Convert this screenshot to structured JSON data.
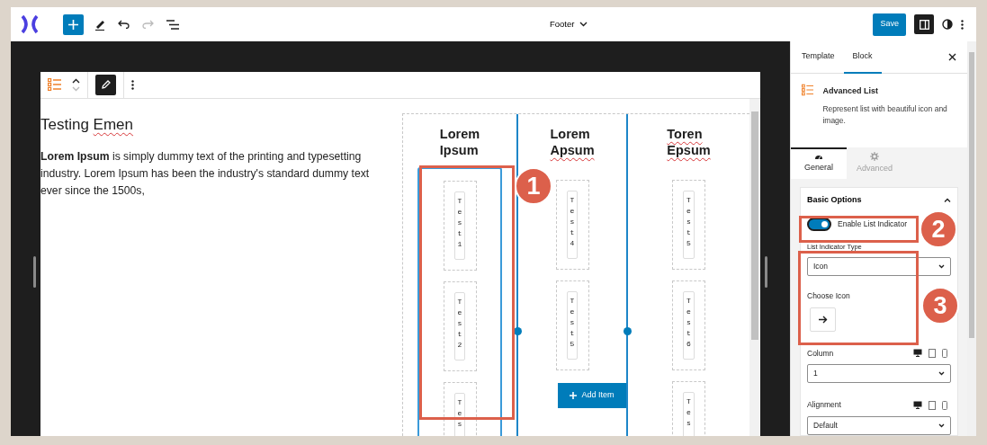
{
  "topbar": {
    "title": "Footer",
    "save_label": "Save"
  },
  "content": {
    "heading": [
      {
        "text": "Testing",
        "misspelled": false
      },
      {
        "text": "Emen",
        "misspelled": true
      }
    ],
    "paragraph": "**Lorem Ipsum** is simply dummy text of the printing and typesetting industry. Lorem Ipsum has been the industry's standard dummy text ever since the 1500s,",
    "list_block": {
      "columns": [
        {
          "heading": [
            {
              "text": "Lorem",
              "misspelled": false
            },
            {
              "text": "Ipsum",
              "misspelled": false
            }
          ],
          "selected": true,
          "items": [
            "Test1",
            "Test2",
            "Tes"
          ]
        },
        {
          "heading": [
            {
              "text": "Lorem",
              "misspelled": false
            },
            {
              "text": "Apsum",
              "misspelled": true
            }
          ],
          "selected": false,
          "items": [
            "Test4",
            "Test5"
          ],
          "add_item": "Add Item"
        },
        {
          "heading": [
            {
              "text": "Toren",
              "misspelled": true
            },
            {
              "text": "Epsum",
              "misspelled": true
            }
          ],
          "selected": false,
          "items": [
            "Test5",
            "Test6",
            "Tes"
          ]
        }
      ]
    }
  },
  "sidebar": {
    "tabs": [
      {
        "label": "Template",
        "selected": false
      },
      {
        "label": "Block",
        "selected": true
      }
    ],
    "block": {
      "name": "Advanced List",
      "description": "Represent list with beautiful icon and image."
    },
    "panel_tabs": [
      {
        "label": "General",
        "selected": true,
        "kind": "gauge"
      },
      {
        "label": "Advanced",
        "selected": false,
        "kind": "gear"
      }
    ],
    "section": {
      "title": "Basic Options",
      "expanded": true
    },
    "toggle": {
      "label": "Enable List Indicator",
      "on": true
    },
    "fields": [
      {
        "kind": "select",
        "label": "List Indicator Type",
        "value": "Icon",
        "responsive": false
      },
      {
        "kind": "icon_picker",
        "label": "Choose Icon"
      },
      {
        "kind": "select",
        "label": "Column",
        "value": "1",
        "responsive": true
      },
      {
        "kind": "select",
        "label": "Alignment",
        "value": "Default",
        "responsive": true
      }
    ]
  },
  "annotations": [
    "1",
    "2",
    "3"
  ]
}
